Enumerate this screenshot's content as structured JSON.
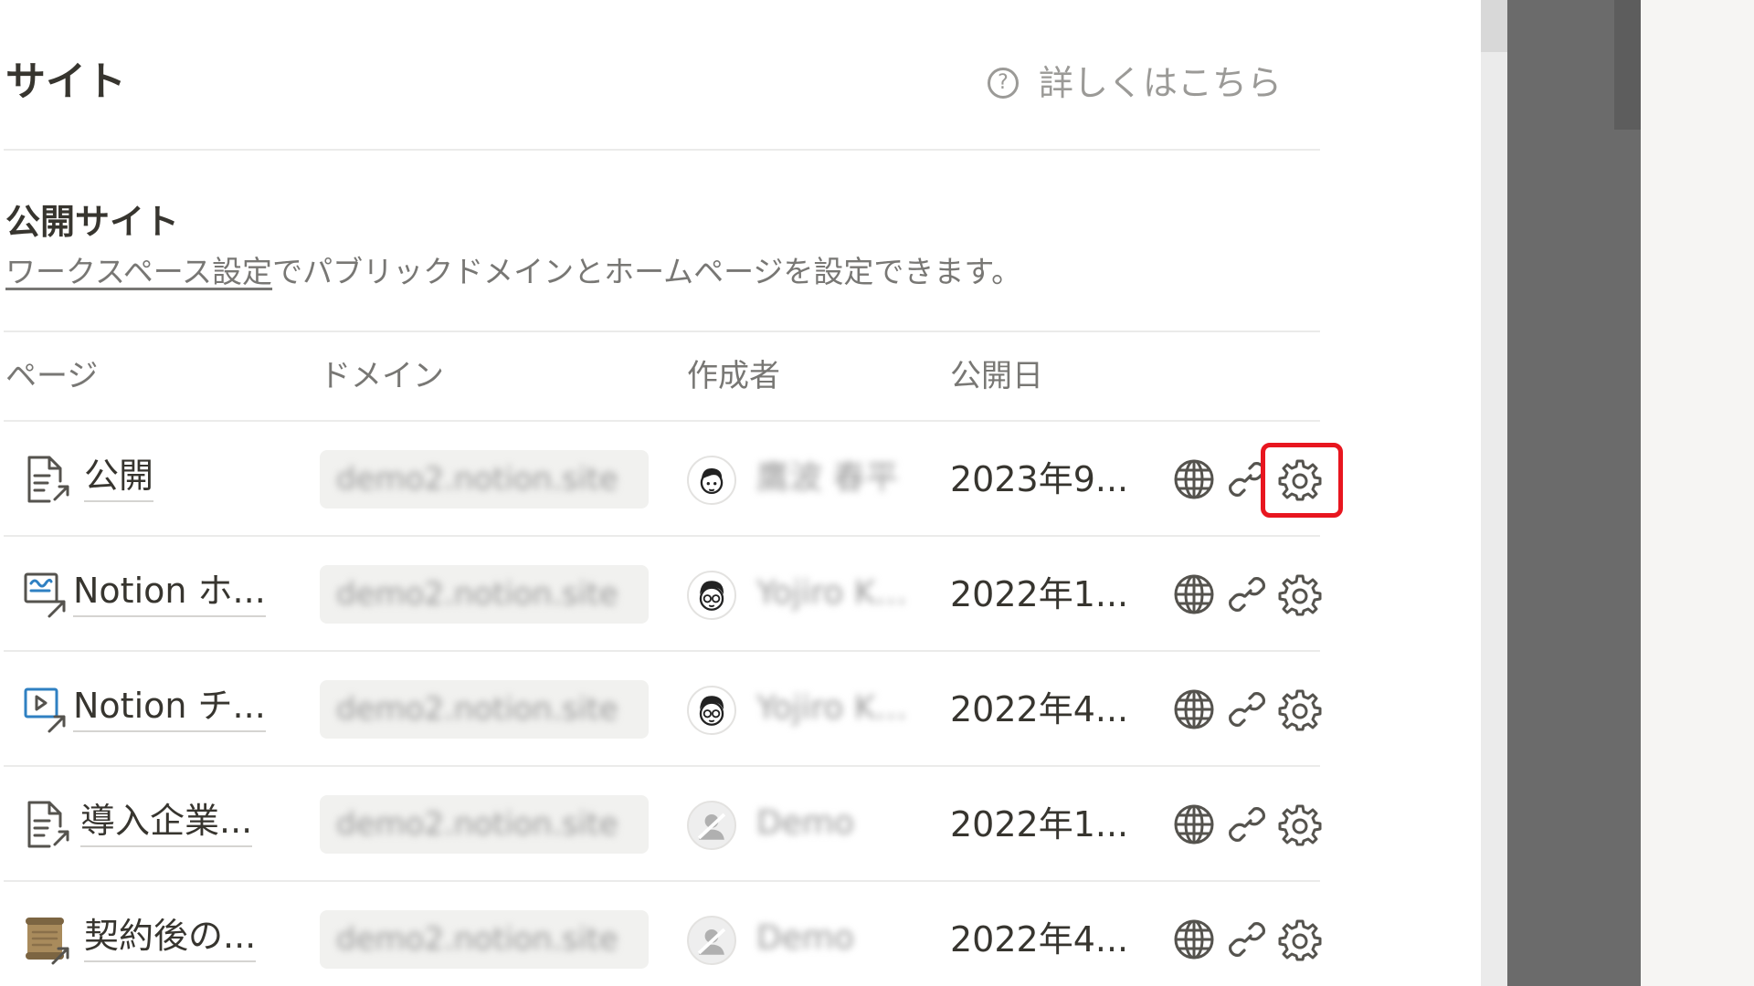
{
  "header": {
    "title": "サイト",
    "learn_more": "詳しくはこちら",
    "help_icon_glyph": "?"
  },
  "section": {
    "title": "公開サイト",
    "description_link": "ワークスペース設定",
    "description_rest": "でパブリックドメインとホームページを設定できます。"
  },
  "columns": {
    "page": "ページ",
    "domain": "ドメイン",
    "creator": "作成者",
    "published": "公開日"
  },
  "rows": [
    {
      "page": "公開",
      "domain": "demo2.notion.site",
      "creator": "鷹波 春平",
      "date": "2023年9...",
      "page_icon": "page-link-icon"
    },
    {
      "page": "Notion ホ...",
      "domain": "demo2.notion.site",
      "creator": "Yojiro K...",
      "date": "2022年1...",
      "page_icon": "drawing-page-link-icon"
    },
    {
      "page": "Notion チ...",
      "domain": "demo2.notion.site",
      "creator": "Yojiro K...",
      "date": "2022年4...",
      "page_icon": "video-page-link-icon"
    },
    {
      "page": "導入企業...",
      "domain": "demo2.notion.site",
      "creator": "Demo",
      "date": "2022年1...",
      "page_icon": "page-link-icon"
    },
    {
      "page": "契約後の...",
      "domain": "demo2.notion.site",
      "creator": "Demo",
      "date": "2022年4...",
      "page_icon": "scroll-page-link-icon"
    }
  ],
  "colors": {
    "text": "#37352f",
    "muted": "#787774",
    "divider": "#ebebea",
    "highlight": "#e8161f",
    "overlay": "#6b6b6b"
  }
}
